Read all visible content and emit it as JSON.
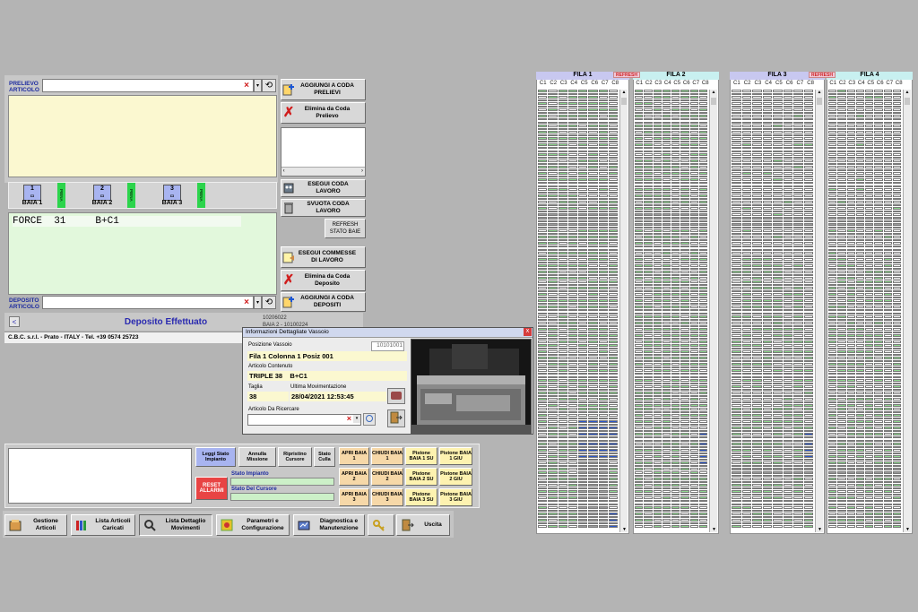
{
  "colors": {
    "bg": "#b4b4b4",
    "green": "#8fd88f",
    "blue": "#2a56c8",
    "gray": "#9a9a9a",
    "white": "#ffffff",
    "red": "#d01c1c",
    "yellow_panel": "#fbf8d0",
    "green_panel": "#e2f8dc"
  },
  "top": {
    "prelievo_label": "PRELIEVO ARTICOLO",
    "deposito_label": "DEPOSITO ARTICOLO",
    "force_text": "FORCE  31     B+C1",
    "status_text": "Deposito Effettuato",
    "status_back": "<",
    "footer_text": "C.B.C. s.r.l. - Prato - ITALY - Tel. +39 0574 25723",
    "small_code_1": "10206022",
    "small_code_2": "BAIA 2 - 10100224"
  },
  "baie": [
    {
      "num": "1",
      "label": "BAIA 1",
      "tag": "PIENA"
    },
    {
      "num": "2",
      "label": "BAIA 2",
      "tag": "PIENA"
    },
    {
      "num": "3",
      "label": "BAIA 3",
      "tag": "PIENA"
    }
  ],
  "right_buttons": {
    "aggiungi_prelievi": "AGGIUNGI A CODA PRELIEVI",
    "elimina_prelievo": "Elimina da Coda Prelievo",
    "esegui_coda": "ESEGUI CODA LAVORO",
    "svuota_coda": "SVUOTA CODA LAVORO",
    "refresh_baie": "REFRESH STATO BAIE",
    "esegui_commesse": "ESEGUI COMMESSE DI LAVORO",
    "elimina_deposito": "Elimina da Coda Deposito",
    "aggiungi_depositi": "AGGIUNGI A CODA DEPOSITI"
  },
  "dialog": {
    "title": "Informazioni Dettagliate Vassoio",
    "close": "x",
    "posizione_label": "Posizione Vassoio",
    "posizione_code": "10101001",
    "posizione_value": "Fila 1 Colonna 1 Posiz 001",
    "articolo_label": "Articolo Contenuto",
    "articolo_value": "TRIPLE 38    B+C1",
    "taglia_label": "Taglia",
    "taglia_value": "38",
    "ultima_label": "Ultima Movimentazione",
    "ultima_value": "28/04/2021 12:53:45",
    "ricercare_label": "Articolo Da Ricercare"
  },
  "controls": {
    "leggi": "Leggi Stato Impianto",
    "annulla": "Annulla Missione",
    "ripristino": "Ripristino Cursore",
    "stato_culla": "Stato Culla",
    "reset": "RESET ALLARMI",
    "stato_impianto": "Stato Impianto",
    "stato_cursore": "Stato Del Cursore",
    "apri": [
      "APRI BAIA 1",
      "APRI BAIA 2",
      "APRI BAIA 3"
    ],
    "chiudi": [
      "CHIUDI BAIA 1",
      "CHIUDI BAIA 2",
      "CHIUDI BAIA 3"
    ],
    "pistone_su": [
      "Pistone BAIA 1 SU",
      "Pistone BAIA 2 SU",
      "Pistone BAIA 3 SU"
    ],
    "pistone_giu": [
      "Pistone BAIA 1 GIU",
      "Pistone BAIA 2 GIU",
      "Pistone BAIA 3 GIU"
    ]
  },
  "bottom_nav": [
    {
      "label": "Gestione Articoli",
      "icon": "inventory-icon"
    },
    {
      "label": "Lista Articoli Caricati",
      "icon": "books-icon"
    },
    {
      "label": "Lista Dettaglio Movimenti",
      "icon": "search-movements-icon"
    },
    {
      "label": "Parametri e Configurazione",
      "icon": "settings-icon"
    },
    {
      "label": "Diagnostica e Manutenzione",
      "icon": "diagnostics-icon"
    },
    {
      "label": "",
      "icon": "keys-icon"
    },
    {
      "label": "Uscita",
      "icon": "exit-door-icon"
    }
  ],
  "grid": {
    "refresh": "REFRESH",
    "fila": [
      "FILA 1",
      "FILA 2",
      "FILA 3",
      "FILA 4"
    ],
    "columns": [
      "C1",
      "C2",
      "C3",
      "C4",
      "C5",
      "C6",
      "C7",
      "C8"
    ]
  }
}
